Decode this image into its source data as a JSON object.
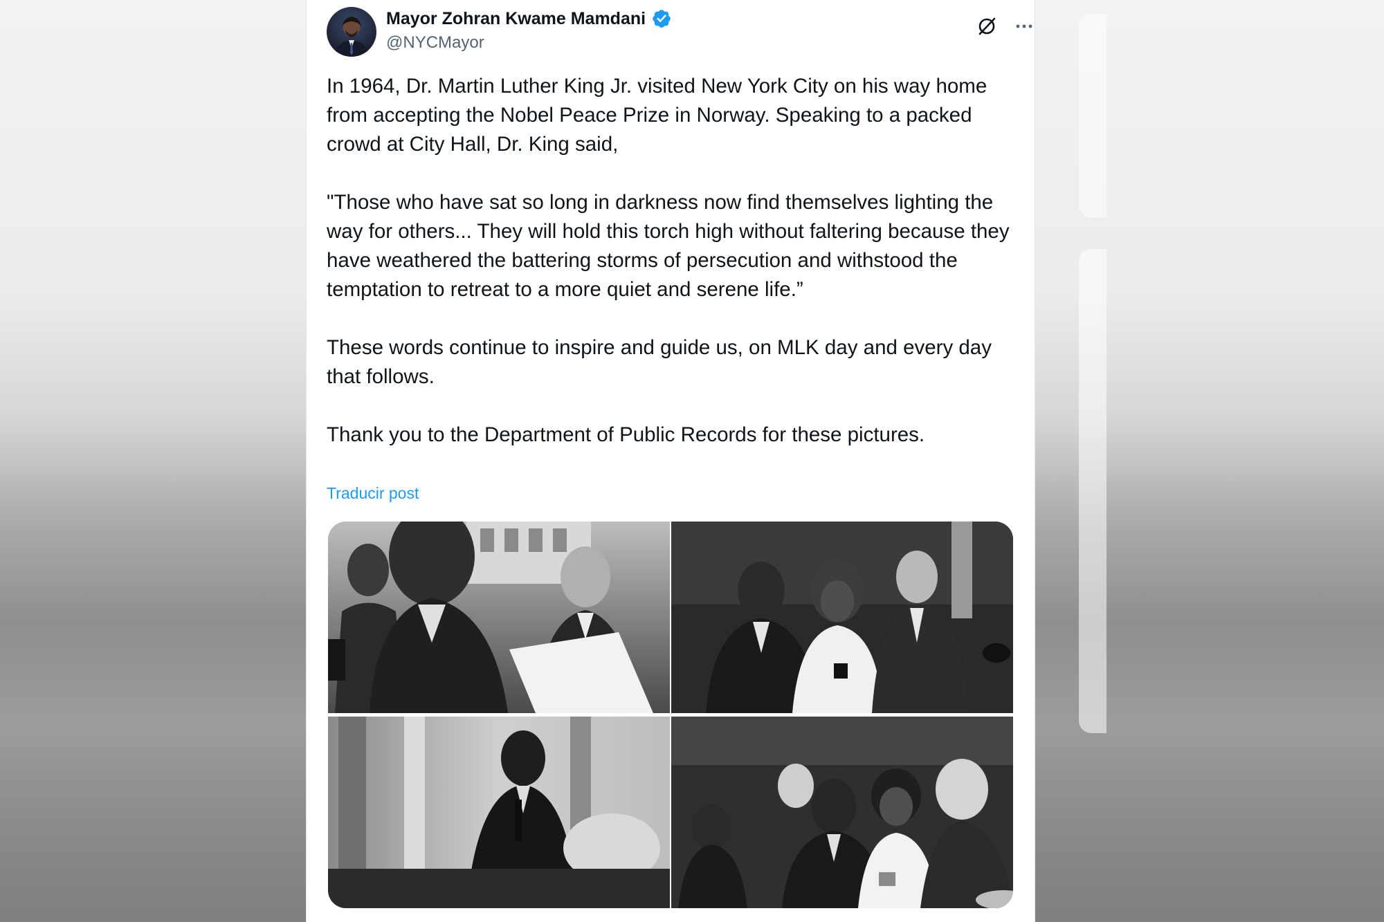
{
  "post": {
    "author_name": "Mayor Zohran Kwame Mamdani",
    "handle": "@NYCMayor",
    "paragraphs": [
      "In 1964, Dr. Martin Luther King Jr. visited New York City on his way home from accepting the Nobel Peace Prize in Norway. Speaking to a packed crowd at City Hall, Dr. King said,",
      "\"Those who have sat so long in darkness now find themselves lighting the way for others... They will hold this torch high without faltering because they have weathered the battering storms of persecution and withstood the temptation to retreat to a more quiet and serene life.”",
      "These words continue to inspire and guide us, on MLK day and every day that follows.",
      "Thank you to the Department of Public Records for these pictures."
    ],
    "translate_label": "Traducir post",
    "icons": {
      "avatar": "avatar",
      "verified": "verified-badge-icon",
      "grok": "grok-icon",
      "more": "more-options-icon"
    },
    "colors": {
      "verified": "#1d9bf0",
      "link": "#1d9bf0",
      "text": "#0f1419",
      "secondary": "#536471"
    }
  }
}
